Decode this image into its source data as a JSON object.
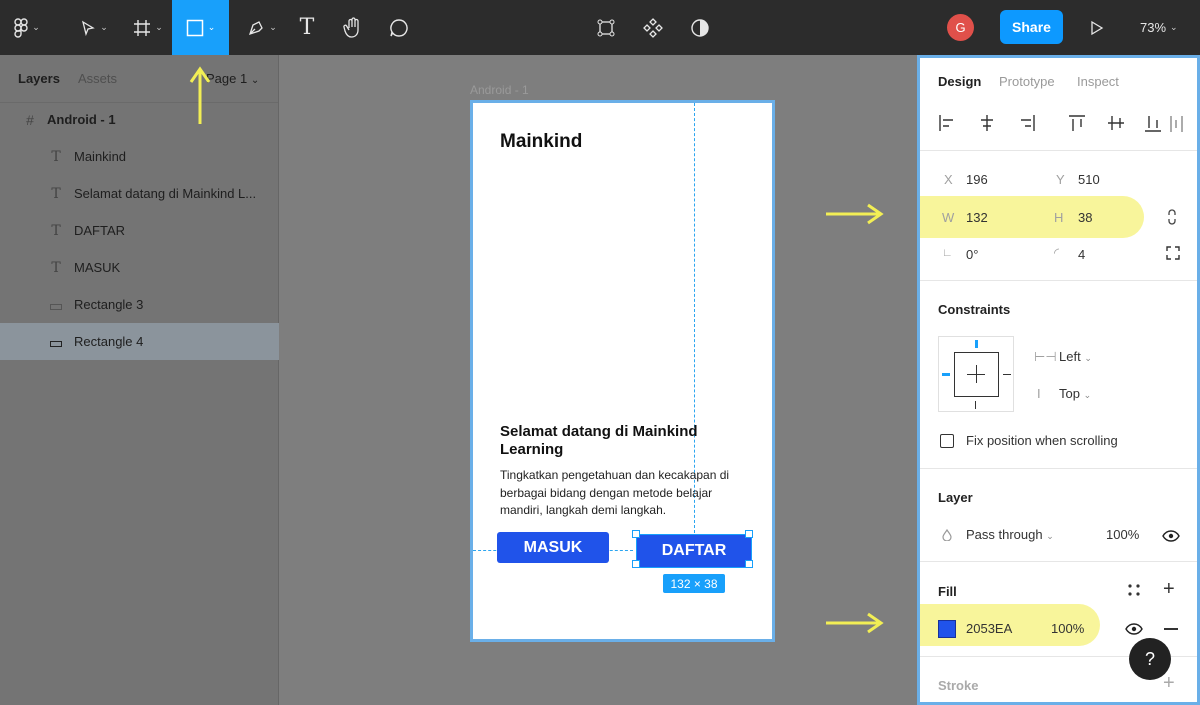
{
  "toolbar": {
    "page_select": "Page 1",
    "share_label": "Share",
    "avatar_initial": "G",
    "zoom": "73%"
  },
  "layers_panel": {
    "tab_layers": "Layers",
    "tab_assets": "Assets",
    "items": [
      {
        "label": "Android - 1",
        "icon": "frame-icon"
      },
      {
        "label": "Mainkind",
        "icon": "text-icon"
      },
      {
        "label": "Selamat datang di Mainkind L...",
        "icon": "text-icon"
      },
      {
        "label": "DAFTAR",
        "icon": "text-icon"
      },
      {
        "label": "MASUK",
        "icon": "text-icon"
      },
      {
        "label": "Rectangle 3",
        "icon": "rectangle-icon"
      },
      {
        "label": "Rectangle 4",
        "icon": "rectangle-icon"
      }
    ]
  },
  "canvas": {
    "frame_label": "Android - 1",
    "title": "Mainkind",
    "heading": "Selamat datang di Mainkind Learning",
    "body": "Tingkatkan pengetahuan dan kecakapan di berbagai bidang dengan metode belajar mandiri, langkah demi langkah.",
    "btn_masuk": "MASUK",
    "btn_daftar": "DAFTAR",
    "size_badge": "132 × 38",
    "button_color": "#2053EA"
  },
  "design_panel": {
    "tab_design": "Design",
    "tab_prototype": "Prototype",
    "tab_inspect": "Inspect",
    "x_label": "X",
    "x_value": "196",
    "y_label": "Y",
    "y_value": "510",
    "w_label": "W",
    "w_value": "132",
    "h_label": "H",
    "h_value": "38",
    "rotation": "0°",
    "radius": "4",
    "constraints_title": "Constraints",
    "constraint_h": "Left",
    "constraint_v": "Top",
    "fix_position": "Fix position when scrolling",
    "layer_title": "Layer",
    "blend_mode": "Pass through",
    "layer_opacity": "100%",
    "fill_title": "Fill",
    "fill_hex": "2053EA",
    "fill_opacity": "100%",
    "stroke_title": "Stroke",
    "help": "?"
  }
}
